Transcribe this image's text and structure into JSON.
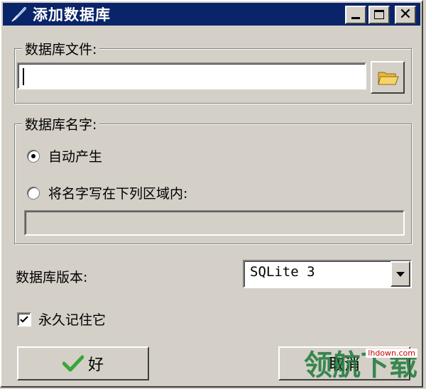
{
  "window": {
    "title": "添加数据库"
  },
  "file_group": {
    "legend": "数据库文件:",
    "path_value": ""
  },
  "name_group": {
    "legend": "数据库名字:",
    "option_auto": "自动产生",
    "option_manual": "将名字写在下列区域内:",
    "selected": "auto",
    "manual_value": ""
  },
  "version": {
    "label": "数据库版本:",
    "selected": "SQLite 3"
  },
  "remember": {
    "label": "永久记住它",
    "checked": true
  },
  "buttons": {
    "ok_label": "好",
    "cancel_label": "取消"
  },
  "watermark": {
    "text": "领航下载",
    "url_text": "lhdown.com"
  },
  "colors": {
    "titlebar": "#0a246a",
    "face": "#d4d0c8",
    "ok_check": "#3aa53a",
    "folder": "#e8b93a"
  }
}
